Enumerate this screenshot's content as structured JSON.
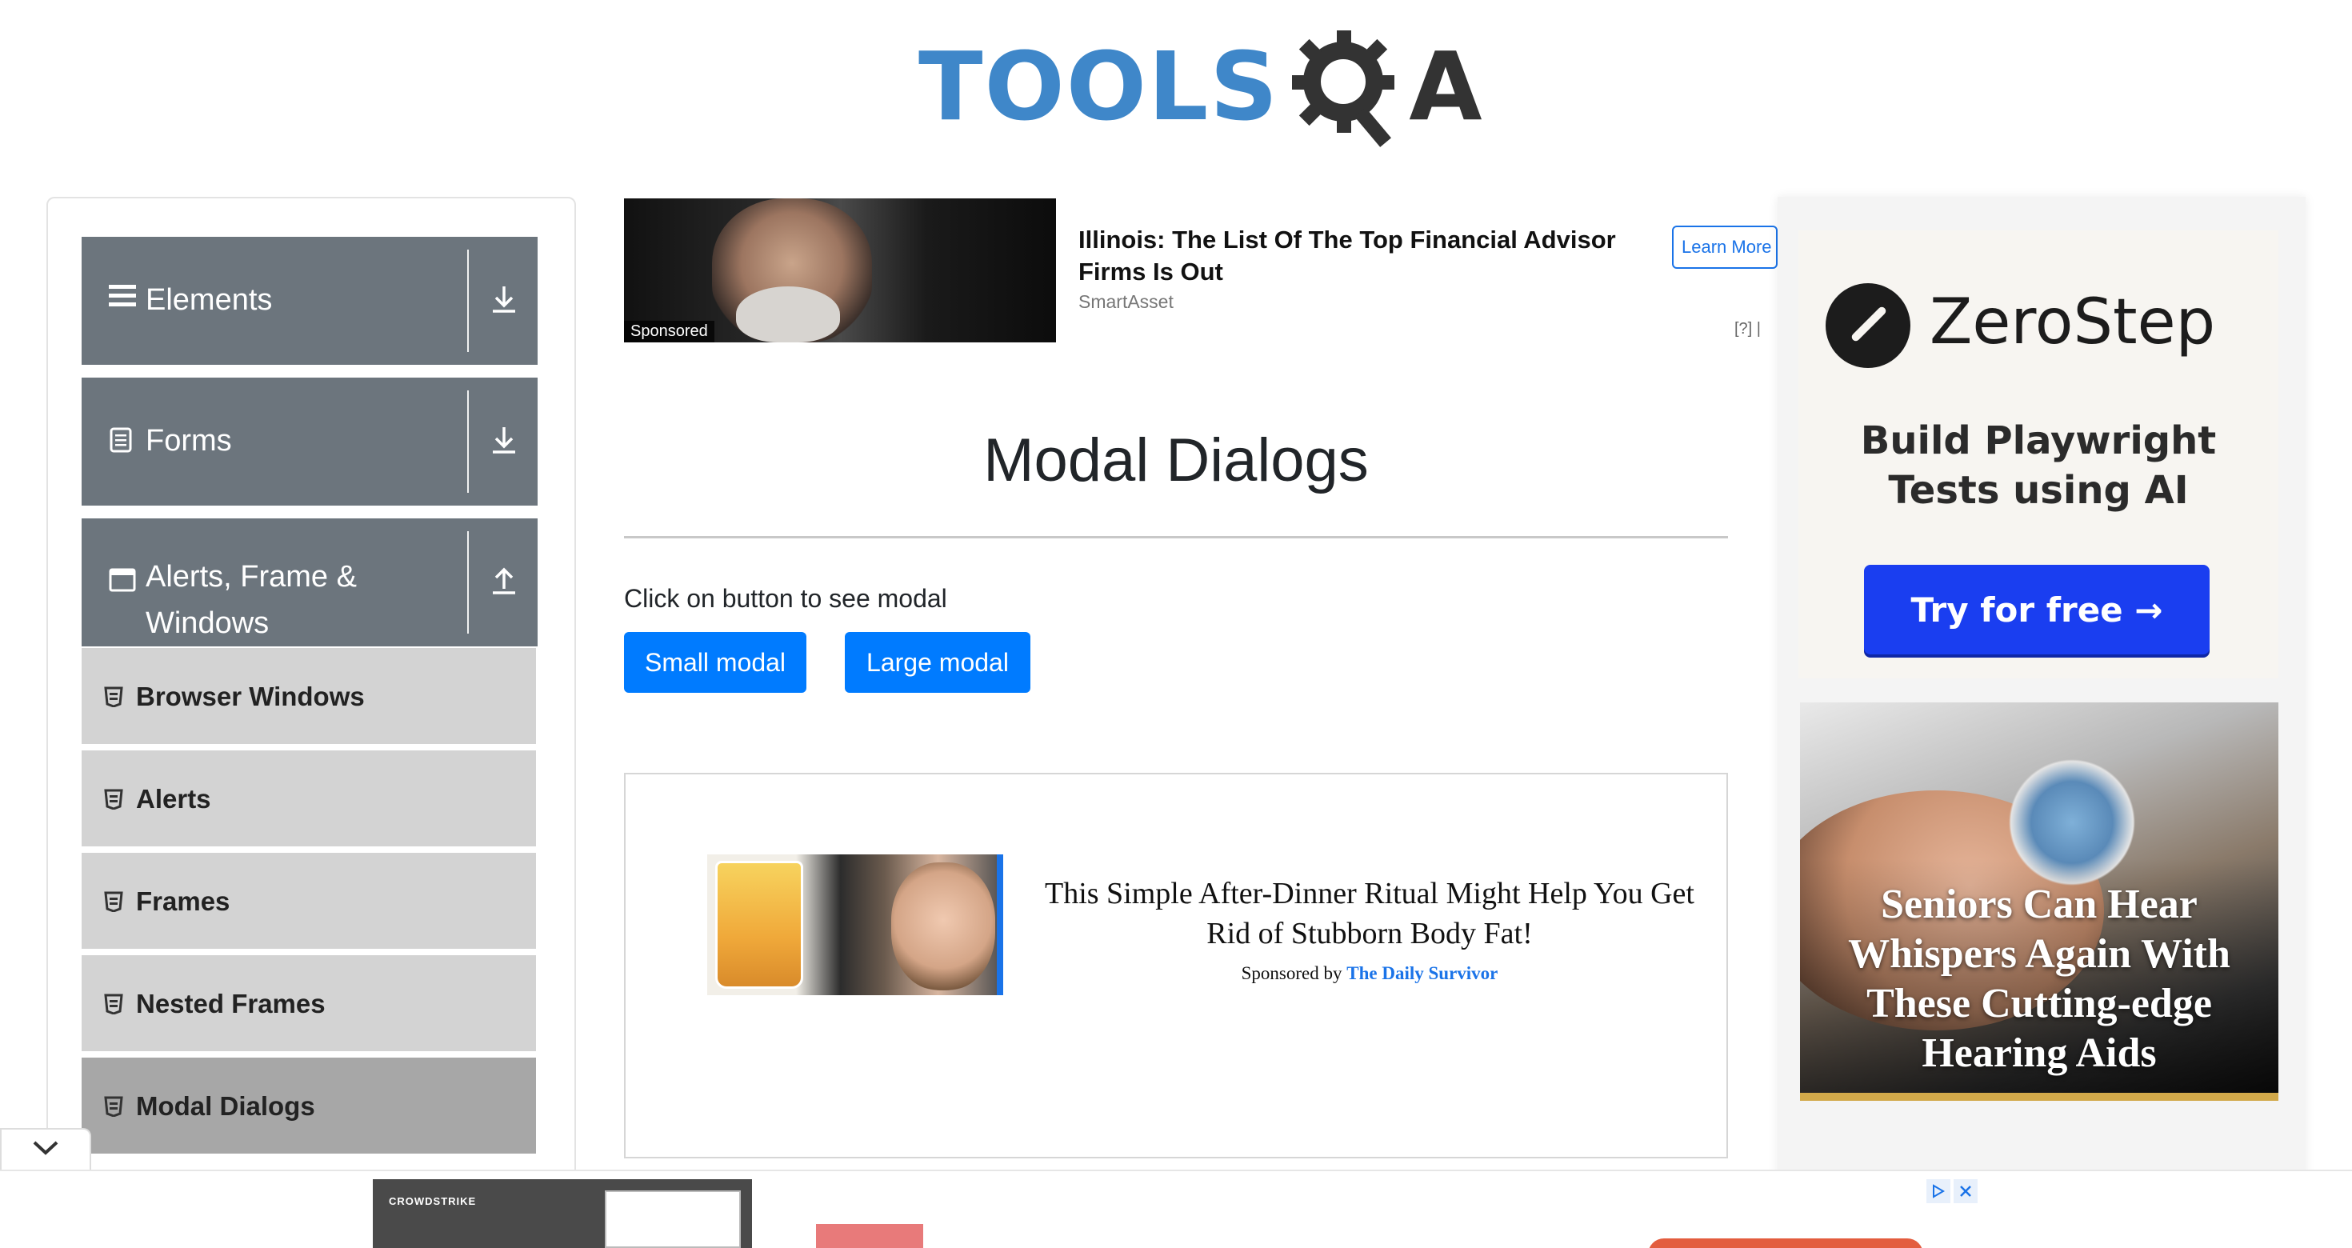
{
  "logo": {
    "word": "TOOLS",
    "suffix": "A"
  },
  "sidebar": {
    "groups": [
      {
        "label": "Elements",
        "icon": "hamburger-icon",
        "arrow": "download-arrow-icon"
      },
      {
        "label": "Forms",
        "icon": "document-icon",
        "arrow": "download-arrow-icon"
      },
      {
        "label_line1": "Alerts, Frame &",
        "label_line2": "Windows",
        "icon": "window-icon",
        "arrow": "upload-arrow-icon"
      }
    ],
    "items": [
      {
        "label": "Browser Windows"
      },
      {
        "label": "Alerts"
      },
      {
        "label": "Frames"
      },
      {
        "label": "Nested Frames"
      },
      {
        "label": "Modal Dialogs"
      }
    ],
    "active_item": "Modal Dialogs"
  },
  "top_ad": {
    "sponsored": "Sponsored",
    "title": "Illinois: The List Of The Top Financial Advisor Firms Is Out",
    "source": "SmartAsset",
    "cta": "Learn More",
    "adchoice": "[?] |"
  },
  "main": {
    "title": "Modal Dialogs",
    "instruction": "Click on button to see modal",
    "small_button": "Small modal",
    "large_button": "Large modal"
  },
  "content_ad": {
    "headline": "This Simple After-Dinner Ritual Might Help You Get Rid of Stubborn Body Fat!",
    "sponsored_prefix": "Sponsored by",
    "sponsor": "The Daily Survivor"
  },
  "right_ad": {
    "brand": "ZeroStep",
    "subtitle_line1": "Build Playwright",
    "subtitle_line2": "Tests using AI",
    "cta": "Try for free →"
  },
  "hearing_ad": {
    "line1": "Seniors Can Hear",
    "line2": "Whispers Again With",
    "line3": "These Cutting-edge",
    "line4": "Hearing Aids"
  },
  "bottom_ad": {
    "brand": "CROWDSTRIKE"
  },
  "colors": {
    "primary_button": "#007bff",
    "group_header": "#6c757d",
    "menu_item": "#d3d3d3",
    "menu_item_active": "#a7a7a7",
    "logo_blue": "#3f87c9",
    "zerostep_button": "#1a3ef0"
  }
}
